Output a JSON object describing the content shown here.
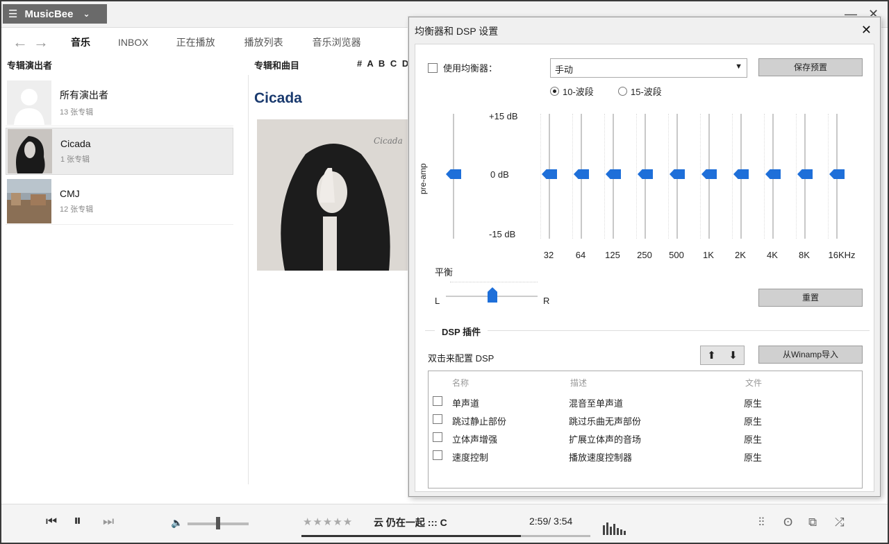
{
  "app": {
    "name": "MusicBee"
  },
  "nav": {
    "tabs": [
      {
        "label": "音乐",
        "active": true
      },
      {
        "label": "INBOX"
      },
      {
        "label": "正在播放"
      },
      {
        "label": "播放列表"
      },
      {
        "label": "音乐浏览器"
      }
    ]
  },
  "browser": {
    "artists_header": "专辑演出者",
    "albums_header": "专辑和曲目",
    "alphabet": "# A B C D E",
    "artists": [
      {
        "name": "所有演出者",
        "count": "13 张专辑"
      },
      {
        "name": "Cicada",
        "count": "1 张专辑"
      },
      {
        "name": "CMJ",
        "count": "12 张专辑"
      }
    ],
    "album_title": "Cicada",
    "cover_text": "Cicada"
  },
  "player": {
    "rating": "★★★★★",
    "track": "云    仍在一起    :::    C",
    "time": "2:59/ 3:54",
    "progress": 0.76,
    "volume": 0.48
  },
  "dialog": {
    "title": "均衡器和 DSP 设置",
    "close": "✕",
    "eq_enable_label": "使用均衡器：",
    "preset_value": "手动",
    "save_preset": "保存预置",
    "band10": "10-波段",
    "band15": "15-波段",
    "db_plus": "+15 dB",
    "db_zero": "0 dB",
    "db_minus": "-15 dB",
    "preamp": "pre-amp",
    "frequencies": [
      "32",
      "64",
      "125",
      "250",
      "500",
      "1K",
      "2K",
      "4K",
      "8K",
      "16KHz"
    ],
    "balance_label": "平衡",
    "balance_l": "L",
    "balance_r": "R",
    "reset": "重置",
    "dsp_header": "DSP 插件",
    "dsp_hint": "双击来配置 DSP",
    "import_winamp": "从Winamp导入",
    "dsp_columns": [
      "名称",
      "描述",
      "文件"
    ],
    "dsp_rows": [
      {
        "name": "单声道",
        "desc": "混音至单声道",
        "file": "原生"
      },
      {
        "name": "跳过静止部份",
        "desc": "跳过乐曲无声部份",
        "file": "原生"
      },
      {
        "name": "立体声增强",
        "desc": "扩展立体声的音场",
        "file": "原生"
      },
      {
        "name": "速度控制",
        "desc": "播放速度控制器",
        "file": "原生"
      }
    ]
  }
}
